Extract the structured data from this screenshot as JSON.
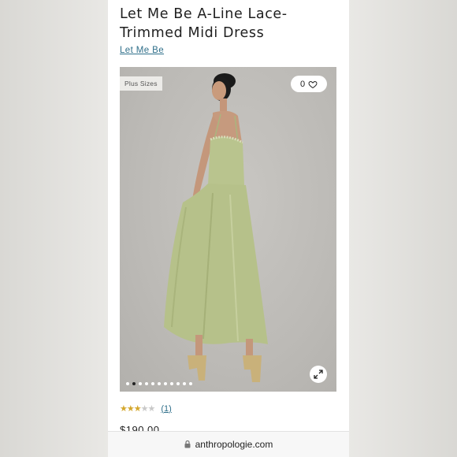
{
  "product": {
    "title": "Let Me Be A-Line Lace-Trimmed Midi Dress",
    "brand": "Let Me Be",
    "badge": "Plus Sizes",
    "favorites_count": "0",
    "rating_stars": 3,
    "rating_max": 5,
    "review_count": "(1)",
    "price": "$190.00"
  },
  "carousel": {
    "total_images": 11,
    "active_index": 1
  },
  "browser": {
    "url": "anthropologie.com"
  },
  "colors": {
    "accent_link": "#2f6f8a",
    "star": "#d4a72c",
    "dress": "#b9c48e"
  },
  "icons": [
    "heart-icon",
    "expand-icon",
    "lock-icon",
    "star-icon"
  ]
}
